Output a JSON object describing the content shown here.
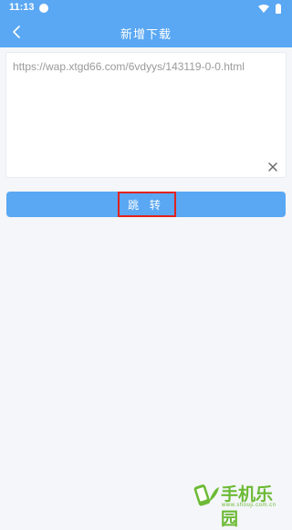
{
  "status_bar": {
    "time": "11:13"
  },
  "header": {
    "title": "新增下载"
  },
  "url_input": {
    "value": "https://wap.xtgd66.com/6vdyys/143119-0-0.html"
  },
  "jump_button": {
    "label": "跳 转"
  },
  "watermark": {
    "text": "手机乐园",
    "sub": "www.shouji.com.cn"
  },
  "colors": {
    "accent": "#5aa7f3",
    "highlight": "#e0241e",
    "watermark": "#6cba35"
  },
  "icons": [
    "wifi-icon",
    "battery-icon",
    "back-arrow-icon",
    "clear-icon"
  ]
}
